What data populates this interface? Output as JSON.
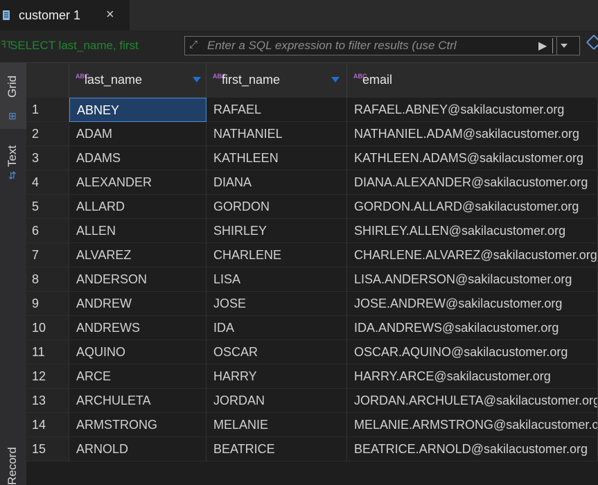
{
  "tab": {
    "label": "customer 1",
    "close": "×"
  },
  "filter": {
    "sql_text": "SELECT last_name, first",
    "placeholder": "Enter a SQL expression to filter results (use Ctrl",
    "run_icon": "▶"
  },
  "sidebar": {
    "grid_label": "Grid",
    "text_label": "Text",
    "record_label": "Record"
  },
  "columns": [
    {
      "abc": "ABC",
      "name": "last_name"
    },
    {
      "abc": "ABC",
      "name": "first_name"
    },
    {
      "abc": "ABC",
      "name": "email"
    }
  ],
  "rows": [
    {
      "n": "1",
      "last": "ABNEY",
      "first": "RAFAEL",
      "email": "RAFAEL.ABNEY@sakilacustomer.org"
    },
    {
      "n": "2",
      "last": "ADAM",
      "first": "NATHANIEL",
      "email": "NATHANIEL.ADAM@sakilacustomer.org"
    },
    {
      "n": "3",
      "last": "ADAMS",
      "first": "KATHLEEN",
      "email": "KATHLEEN.ADAMS@sakilacustomer.org"
    },
    {
      "n": "4",
      "last": "ALEXANDER",
      "first": "DIANA",
      "email": "DIANA.ALEXANDER@sakilacustomer.org"
    },
    {
      "n": "5",
      "last": "ALLARD",
      "first": "GORDON",
      "email": "GORDON.ALLARD@sakilacustomer.org"
    },
    {
      "n": "6",
      "last": "ALLEN",
      "first": "SHIRLEY",
      "email": "SHIRLEY.ALLEN@sakilacustomer.org"
    },
    {
      "n": "7",
      "last": "ALVAREZ",
      "first": "CHARLENE",
      "email": "CHARLENE.ALVAREZ@sakilacustomer.org"
    },
    {
      "n": "8",
      "last": "ANDERSON",
      "first": "LISA",
      "email": "LISA.ANDERSON@sakilacustomer.org"
    },
    {
      "n": "9",
      "last": "ANDREW",
      "first": "JOSE",
      "email": "JOSE.ANDREW@sakilacustomer.org"
    },
    {
      "n": "10",
      "last": "ANDREWS",
      "first": "IDA",
      "email": "IDA.ANDREWS@sakilacustomer.org"
    },
    {
      "n": "11",
      "last": "AQUINO",
      "first": "OSCAR",
      "email": "OSCAR.AQUINO@sakilacustomer.org"
    },
    {
      "n": "12",
      "last": "ARCE",
      "first": "HARRY",
      "email": "HARRY.ARCE@sakilacustomer.org"
    },
    {
      "n": "13",
      "last": "ARCHULETA",
      "first": "JORDAN",
      "email": "JORDAN.ARCHULETA@sakilacustomer.org"
    },
    {
      "n": "14",
      "last": "ARMSTRONG",
      "first": "MELANIE",
      "email": "MELANIE.ARMSTRONG@sakilacustomer.org"
    },
    {
      "n": "15",
      "last": "ARNOLD",
      "first": "BEATRICE",
      "email": "BEATRICE.ARNOLD@sakilacustomer.org"
    }
  ],
  "selected_row": "1"
}
